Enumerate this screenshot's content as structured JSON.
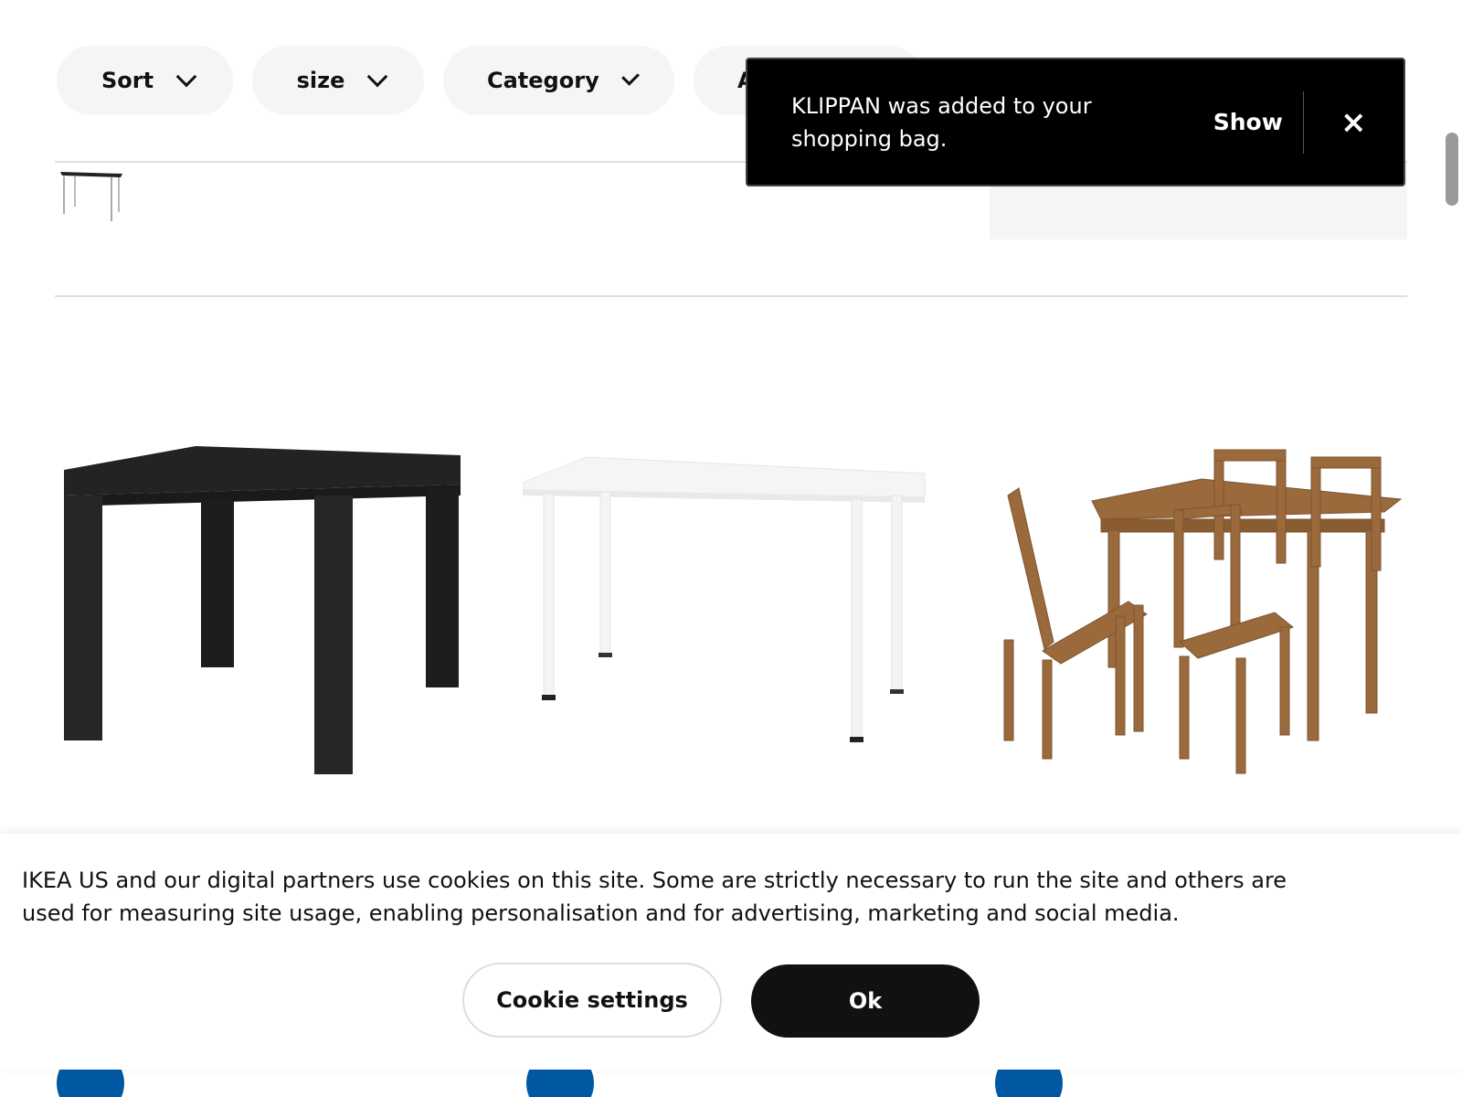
{
  "filters": {
    "sort_label": "Sort",
    "size_label": "size",
    "category_label": "Category",
    "availability_label": "A"
  },
  "toast": {
    "message": "KLIPPAN was added to your shopping bag.",
    "show_label": "Show",
    "close_icon": "×"
  },
  "products": [
    {
      "image": "black-side-table",
      "color": "#1e1e1e"
    },
    {
      "image": "white-desk",
      "color": "#f4f4f4"
    },
    {
      "image": "wood-dining-set",
      "color": "#9a6a3c"
    }
  ],
  "cookie": {
    "text": "IKEA US and our digital partners use cookies on this site. Some are strictly necessary to run the site and others are used for measuring site usage, enabling personalisation and for advertising, marketing and social media.",
    "settings_label": "Cookie settings",
    "ok_label": "Ok"
  },
  "colors": {
    "brand_blue": "#0058a3",
    "toast_bg": "#000000"
  }
}
